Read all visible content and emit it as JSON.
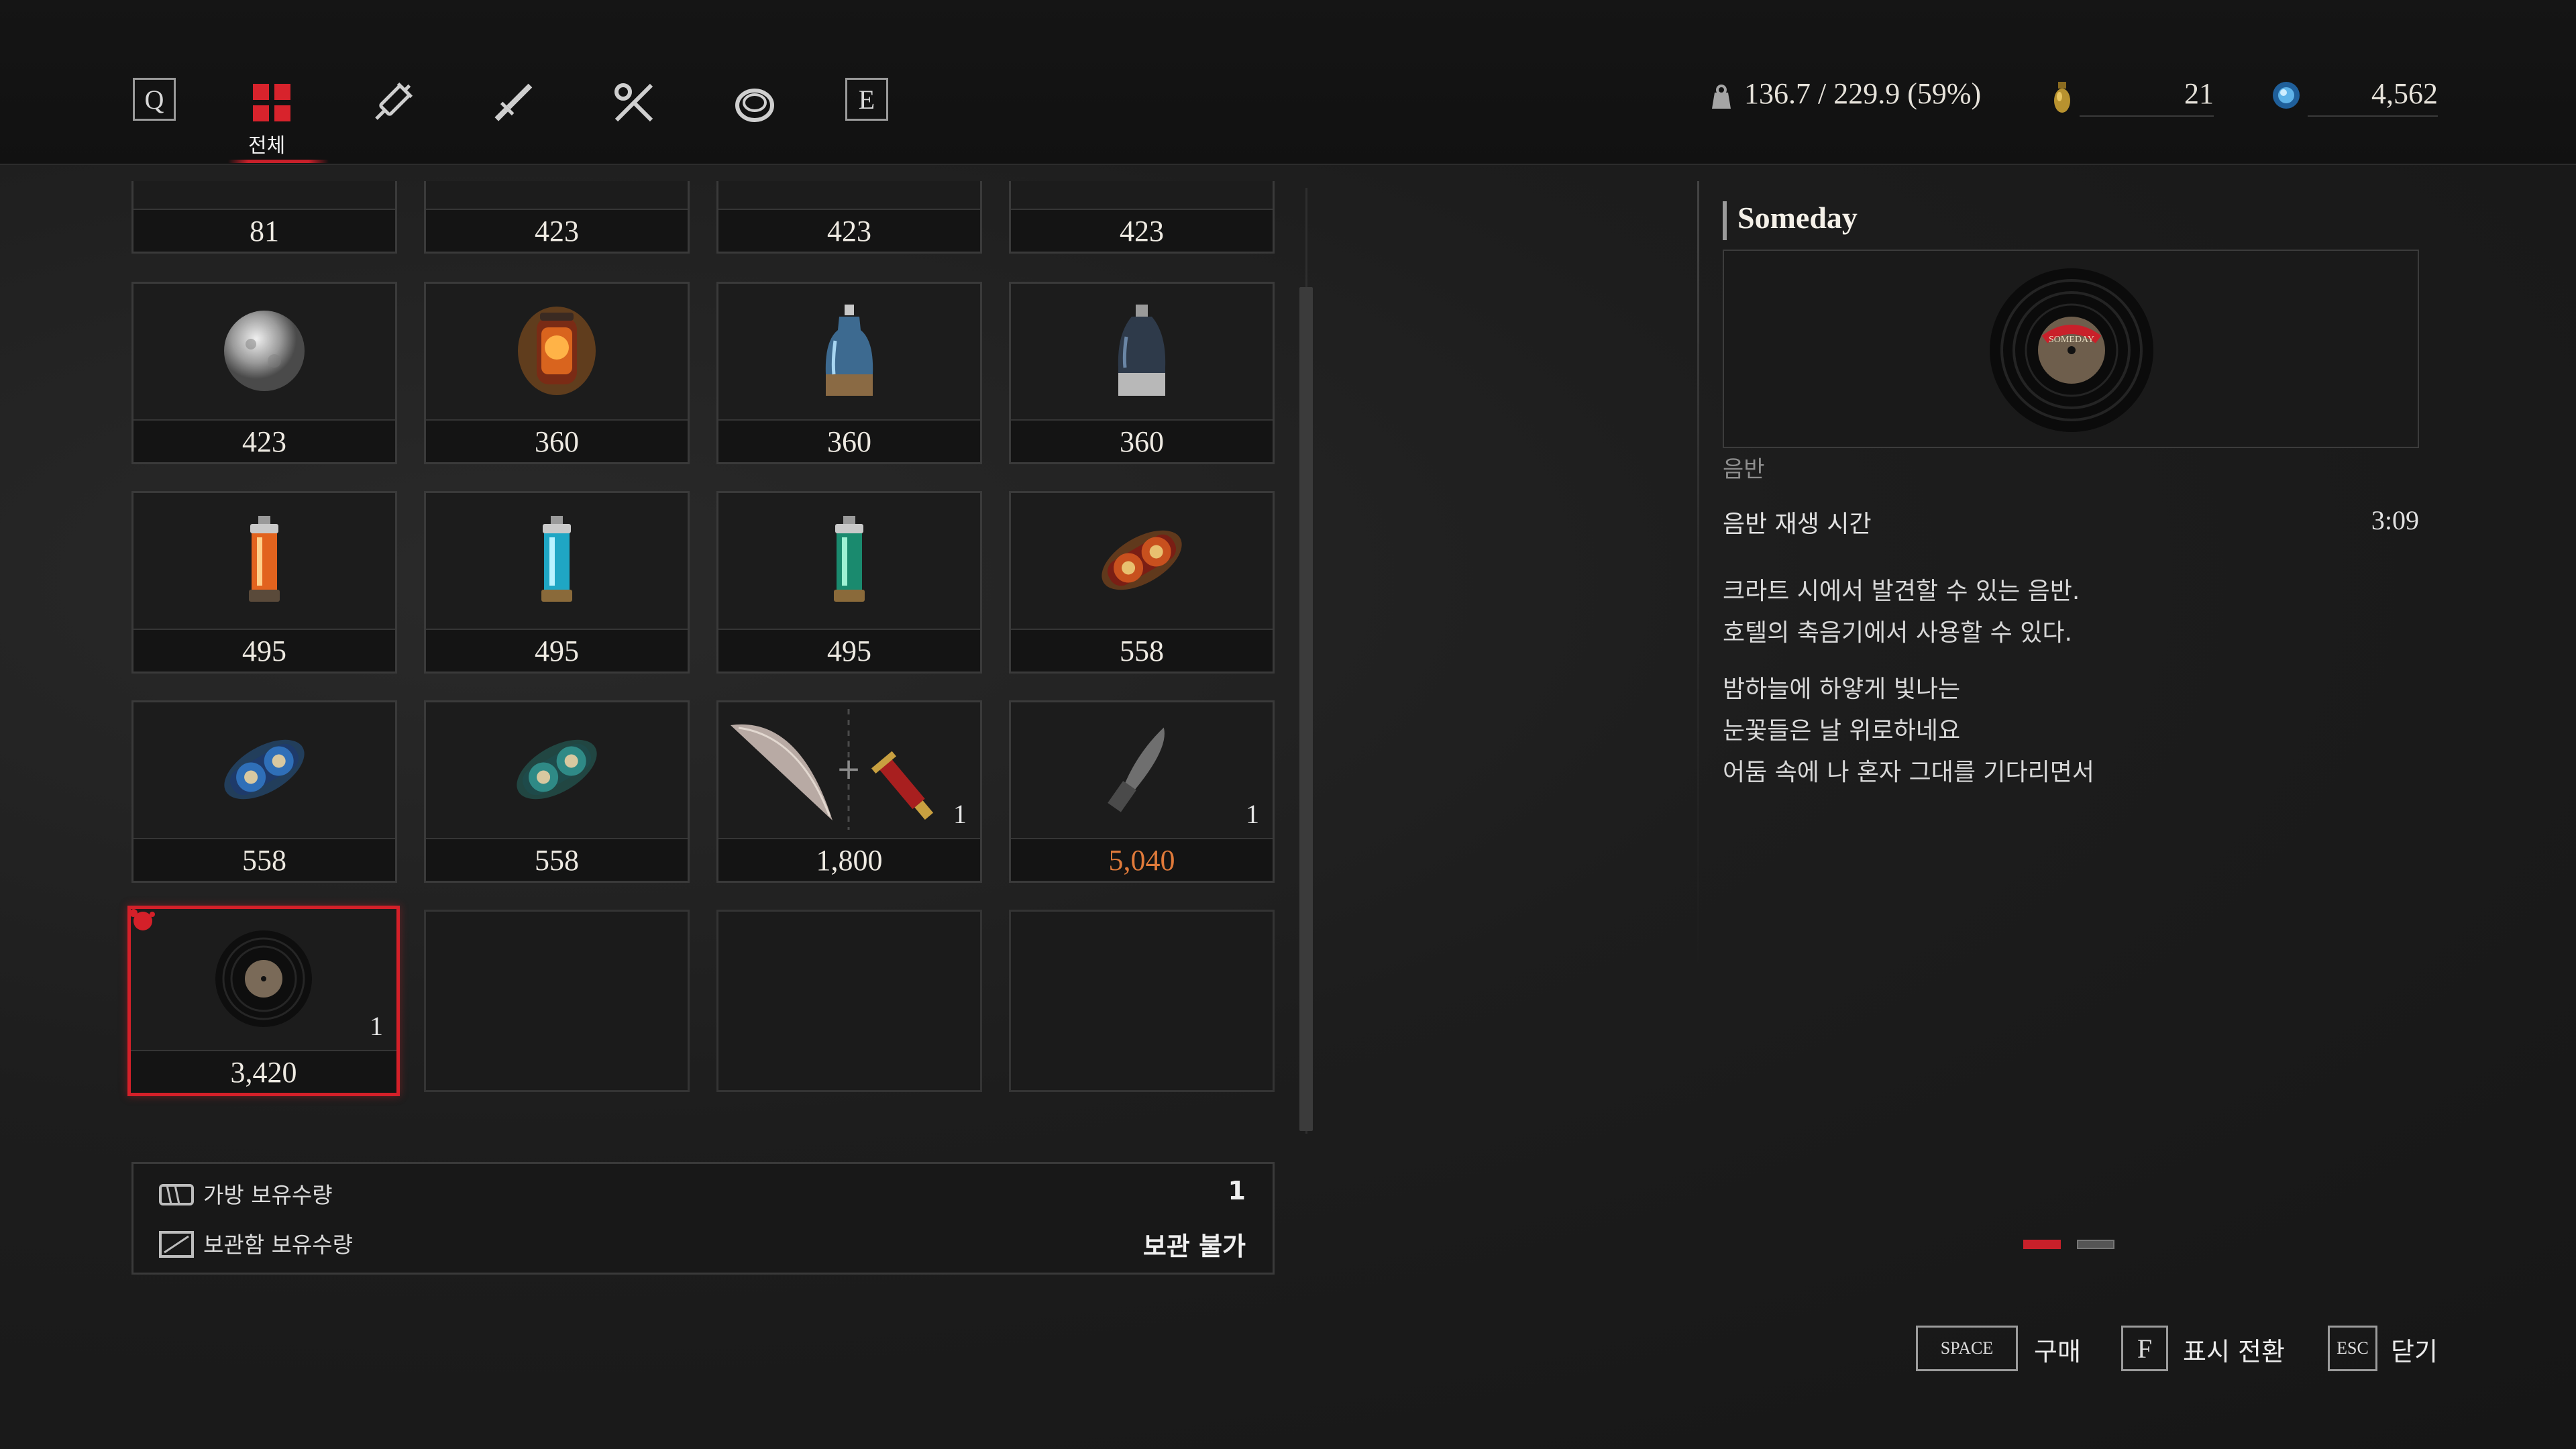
{
  "topbar": {
    "left_key": "Q",
    "right_key": "E",
    "active_tab_label": "전체",
    "tabs": [
      {
        "icon": "grid-icon"
      },
      {
        "icon": "syringe-icon"
      },
      {
        "icon": "dagger-icon"
      },
      {
        "icon": "tool-icon"
      },
      {
        "icon": "ring-icon"
      }
    ],
    "weight": "136.7 / 229.9 (59%)",
    "ergo_count": "21",
    "currency": "4,562",
    "accent_color": "#c8202a"
  },
  "grid": {
    "rows": [
      [
        {
          "price": "81"
        },
        {
          "price": "423"
        },
        {
          "price": "423"
        },
        {
          "price": "423"
        }
      ],
      [
        {
          "price": "423",
          "icon": "moon-stone-icon"
        },
        {
          "price": "360",
          "icon": "fire-canister-icon"
        },
        {
          "price": "360",
          "icon": "blue-flask-icon"
        },
        {
          "price": "360",
          "icon": "dark-flask-icon"
        }
      ],
      [
        {
          "price": "495",
          "icon": "red-lantern-icon"
        },
        {
          "price": "495",
          "icon": "cyan-lantern-icon"
        },
        {
          "price": "495",
          "icon": "green-lantern-icon"
        },
        {
          "price": "558",
          "icon": "fire-gear-icon"
        }
      ],
      [
        {
          "price": "558",
          "icon": "blue-gear-icon"
        },
        {
          "price": "558",
          "icon": "teal-gear-icon"
        },
        {
          "price": "1,800",
          "icon": "feather-dagger-icon",
          "count": "1"
        },
        {
          "price": "5,040",
          "icon": "grey-blade-icon",
          "count": "1",
          "highlight": "#e07a3a"
        }
      ],
      [
        {
          "price": "3,420",
          "icon": "vinyl-record-icon",
          "count": "1",
          "selected": true
        },
        {
          "empty": true
        },
        {
          "empty": true
        },
        {
          "empty": true
        }
      ]
    ]
  },
  "holdings": {
    "bag_label": "가방 보유수량",
    "bag_value": "1",
    "storage_label": "보관함 보유수량",
    "storage_value": "보관 불가"
  },
  "detail": {
    "title": "Someday",
    "category": "음반",
    "property_label": "음반 재생 시간",
    "property_value": "3:09",
    "description": [
      "크라트 시에서 발견할 수 있는 음반.",
      "호텔의 축음기에서 사용할 수 있다."
    ],
    "lyrics": [
      "밤하늘에 하얗게 빛나는",
      "눈꽃들은 날 위로하네요",
      "어둠 속에 나 혼자 그대를 기다리면서"
    ],
    "record_label_text": "SOMEDAY"
  },
  "controls": {
    "buy_key": "SPACE",
    "buy_label": "구매",
    "toggle_key": "F",
    "toggle_label": "표시 전환",
    "close_key": "ESC",
    "close_label": "닫기"
  }
}
